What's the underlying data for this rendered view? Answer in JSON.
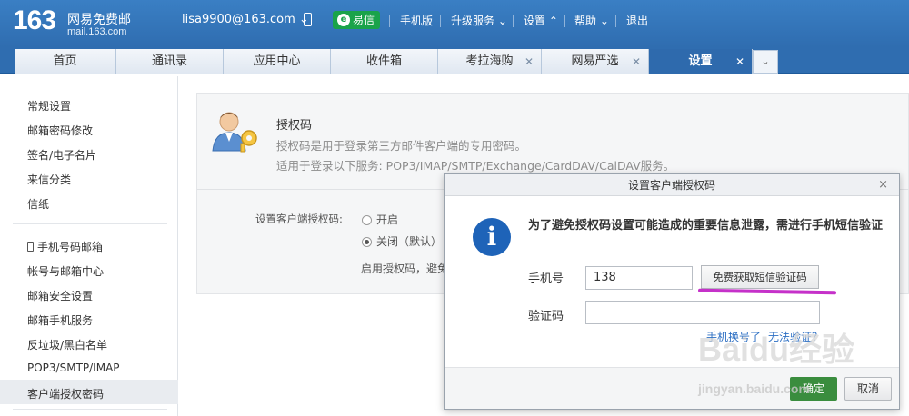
{
  "header": {
    "logo_number": "163",
    "logo_name": "网易免费邮",
    "logo_domain": "mail.163.com",
    "user_email": "lisa9900@163.com",
    "yixin_label": "易信",
    "mobile_label": "手机版",
    "upgrade_label": "升级服务",
    "settings_label": "设置",
    "help_label": "帮助",
    "logout_label": "退出"
  },
  "tabs": [
    {
      "label": "首页"
    },
    {
      "label": "通讯录"
    },
    {
      "label": "应用中心"
    },
    {
      "label": "收件箱"
    },
    {
      "label": "考拉海购"
    },
    {
      "label": "网易严选"
    },
    {
      "label": "设置"
    }
  ],
  "sidebar": {
    "items": [
      "常规设置",
      "邮箱密码修改",
      "签名/电子名片",
      "来信分类",
      "信纸",
      "手机号码邮箱",
      "帐号与邮箱中心",
      "邮箱安全设置",
      "邮箱手机服务",
      "反垃圾/黑白名单",
      "POP3/SMTP/IMAP",
      "客户端授权密码"
    ]
  },
  "main": {
    "title": "授权码",
    "desc1": "授权码是用于登录第三方邮件客户端的专用密码。",
    "desc2": "适用于登录以下服务: POP3/IMAP/SMTP/Exchange/CardDAV/CalDAV服务。",
    "setting_label": "设置客户端授权码:",
    "option_on": "开启",
    "option_off": "关闭（默认）",
    "hint": "启用授权码，避免"
  },
  "dialog": {
    "title": "设置客户端授权码",
    "close": "×",
    "message": "为了避免授权码设置可能造成的重要信息泄露，需进行手机短信验证",
    "phone_label": "手机号",
    "phone_value": "138",
    "sms_button": "免费获取短信验证码",
    "code_label": "验证码",
    "code_value": "",
    "changed_link": "手机换号了",
    "cannot_verify_link": "无法验证？",
    "ok": "确定",
    "cancel": "取消"
  },
  "watermark": {
    "brand": "Baidu经验",
    "url": "jingyan.baidu.com"
  },
  "colors": {
    "header_blue": "#2f6db0",
    "ok_green": "#3a8d3e",
    "highlight_purple": "#c531c9",
    "info_blue": "#1e63b8"
  }
}
